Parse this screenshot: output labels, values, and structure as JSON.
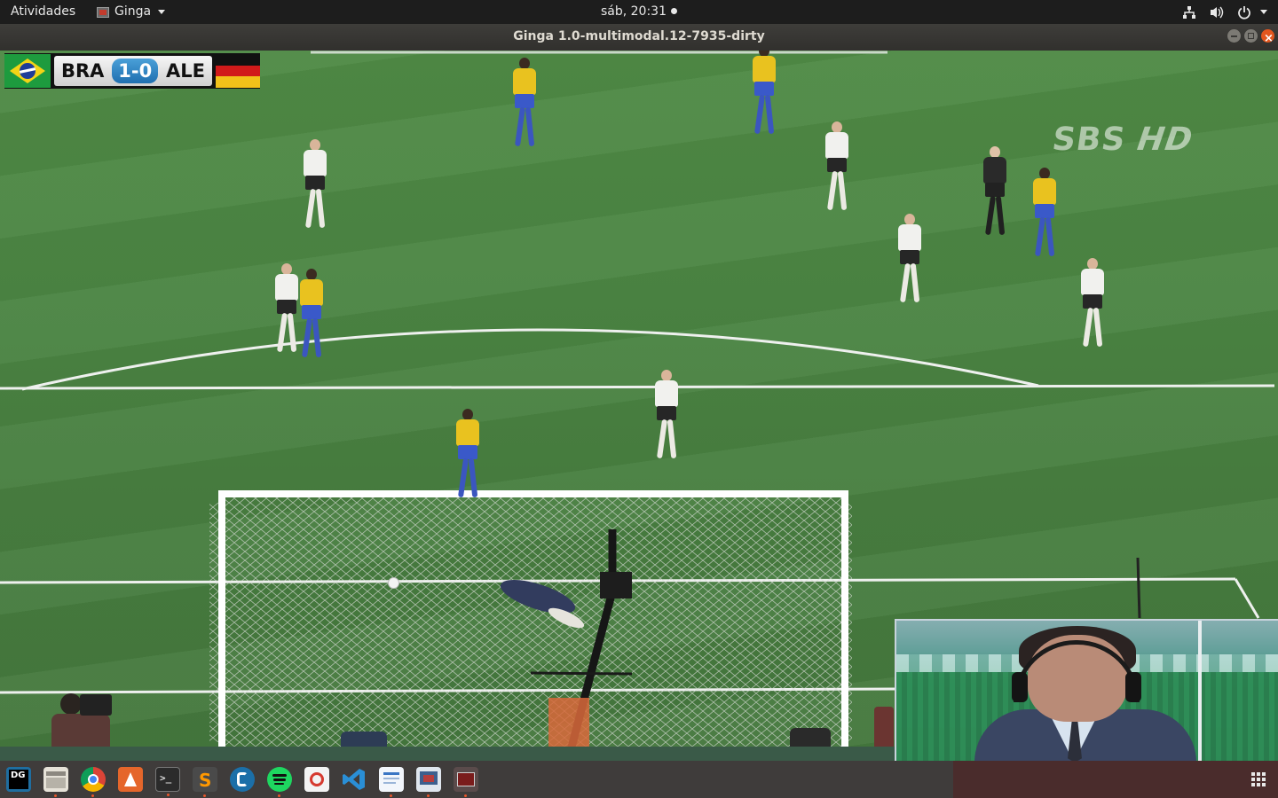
{
  "topbar": {
    "activities": "Atividades",
    "app_name": "Ginga",
    "clock": "sáb, 20:31",
    "tray_icons": [
      "network-icon",
      "volume-icon",
      "power-icon"
    ]
  },
  "window": {
    "title": "Ginga 1.0-multimodal.12-7935-dirty",
    "buttons": [
      "minimize-button",
      "maximize-button",
      "close-button"
    ]
  },
  "video": {
    "scoreboard": {
      "home": "BRA",
      "result": "1-0",
      "away": "ALE"
    },
    "watermark": {
      "brand": "SBS",
      "suffix": "HD"
    },
    "colors": {
      "pitch": "#4b8543",
      "brazil_shirt": "#e9c21f",
      "germany_shirt": "#f1f1ee",
      "scoreboard_accent": "#1f6fb0"
    }
  },
  "dock": {
    "apps": [
      {
        "name": "datagrip-icon",
        "label": "DG"
      },
      {
        "name": "files-icon"
      },
      {
        "name": "chrome-icon"
      },
      {
        "name": "software-center-icon"
      },
      {
        "name": "terminal-icon",
        "label": ">_"
      },
      {
        "name": "sublime-icon",
        "label": "S"
      },
      {
        "name": "remmina-icon"
      },
      {
        "name": "spotify-icon"
      },
      {
        "name": "pdf-viewer-icon"
      },
      {
        "name": "vscode-icon"
      },
      {
        "name": "text-editor-icon"
      },
      {
        "name": "screenshot-icon"
      },
      {
        "name": "ginga-icon"
      }
    ],
    "apps_grid": "show-applications-icon"
  }
}
